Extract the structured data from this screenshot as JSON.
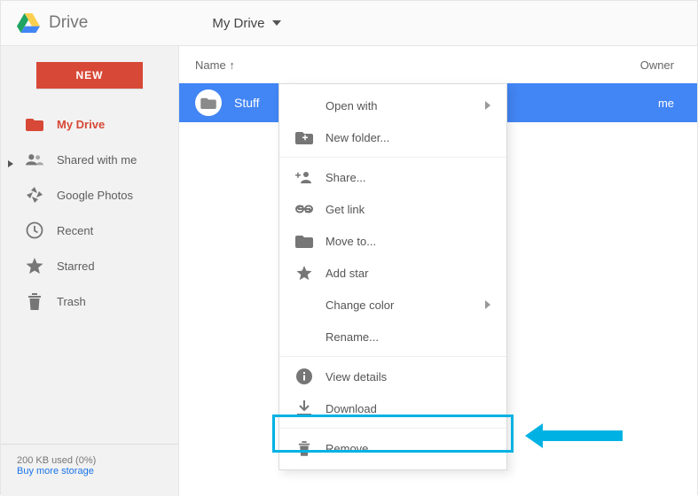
{
  "header": {
    "app_name": "Drive",
    "breadcrumb": "My Drive"
  },
  "sidebar": {
    "new_label": "NEW",
    "items": [
      {
        "label": "My Drive"
      },
      {
        "label": "Shared with me"
      },
      {
        "label": "Google Photos"
      },
      {
        "label": "Recent"
      },
      {
        "label": "Starred"
      },
      {
        "label": "Trash"
      }
    ],
    "storage_text": "200 KB used (0%)",
    "storage_link": "Buy more storage"
  },
  "columns": {
    "name": "Name",
    "owner": "Owner"
  },
  "row": {
    "name": "Stuff",
    "owner": "me"
  },
  "context_menu": {
    "open_with": "Open with",
    "new_folder": "New folder...",
    "share": "Share...",
    "get_link": "Get link",
    "move_to": "Move to...",
    "add_star": "Add star",
    "change_color": "Change color",
    "rename": "Rename...",
    "view_details": "View details",
    "download": "Download",
    "remove": "Remove"
  }
}
